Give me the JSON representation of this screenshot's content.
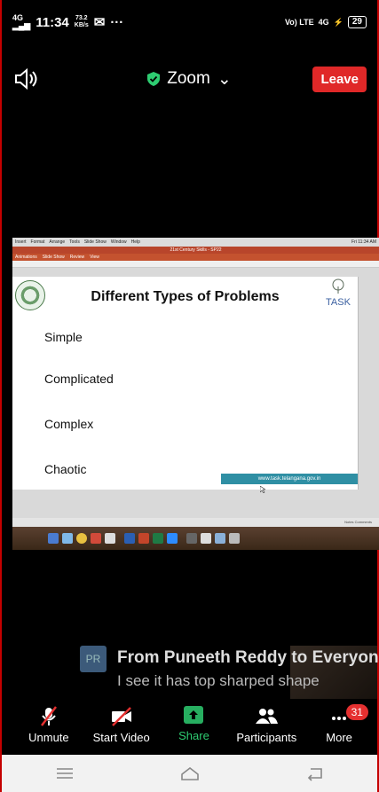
{
  "status_bar": {
    "network_type": "4G",
    "time": "11:34",
    "speed_value": "73.2",
    "speed_unit": "KB/s",
    "right_net": "Vo) LTE",
    "right_4g": "4G",
    "battery": "29"
  },
  "meeting": {
    "title": "Zoom",
    "leave_label": "Leave"
  },
  "shared_screen": {
    "mac_menu": [
      "Insert",
      "Format",
      "Arrange",
      "Tools",
      "Slide Show",
      "Window",
      "Help"
    ],
    "mac_menu_right": "Fri 11:34 AM",
    "ppt_title": "21st Century Skills - SP22",
    "ppt_ribbon": [
      "Animations",
      "Slide Show",
      "Review",
      "View"
    ],
    "slide": {
      "heading": "Different Types of Problems",
      "task_logo_text": "TASK",
      "problems": [
        "Simple",
        "Complicated",
        "Complex",
        "Chaotic"
      ],
      "footer_url": "www.task.telangana.gov.in"
    },
    "ppt_status": "Notes  Comments"
  },
  "chat": {
    "avatar_initials": "PR",
    "from_line": "From Puneeth Reddy to Everyone",
    "message": "I see it has top sharped shape"
  },
  "toolbar": {
    "unmute_label": "Unmute",
    "start_video_label": "Start Video",
    "share_label": "Share",
    "participants_label": "Participants",
    "more_label": "More",
    "more_badge": "31"
  },
  "colors": {
    "leave_bg": "#e02828",
    "share_green": "#27ae60",
    "badge_red": "#e53030"
  }
}
